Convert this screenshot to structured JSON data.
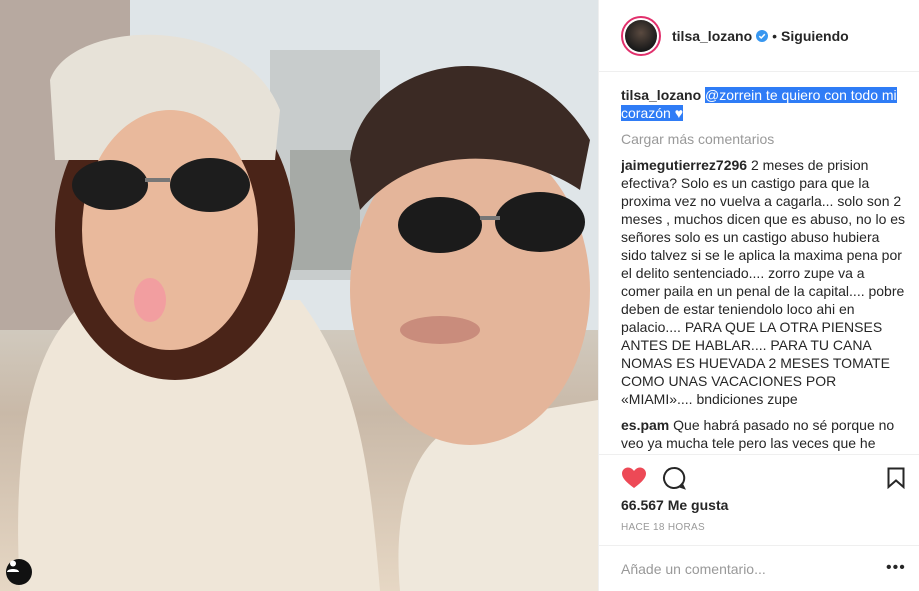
{
  "header": {
    "username": "tilsa_lozano",
    "separator": "•",
    "follow_status": "Siguiendo",
    "verified_icon": "verified-badge-icon"
  },
  "caption": {
    "user": "tilsa_lozano",
    "text": "@zorrein te quiero con todo mi corazón",
    "emoji": "♥"
  },
  "load_more": "Cargar más comentarios",
  "comments": [
    {
      "user": "jaimegutierrez7296",
      "text": "2 meses de prision efectiva? Solo es un castigo para que la proxima vez no vuelva a cagarla... solo son 2 meses , muchos dicen que es abuso, no lo es señores solo es un castigo abuso hubiera sido talvez si se le aplica la maxima pena por el delito sentenciado.... zorro zupe va a comer paila en un penal de la capital.... pobre deben de estar teniendolo loco ahi en palacio.... PARA QUE LA OTRA PIENSES ANTES DE HABLAR.... PARA TU CANA NOMAS ES HUEVADA 2 MESES TOMATE COMO UNAS VACACIONES POR «MIAMI».... bndiciones zupe"
    },
    {
      "user": "es.pam",
      "text": "Que habrá pasado no sé porque no veo ya mucha tele pero las veces que he"
    }
  ],
  "actions": {
    "like_icon": "heart-icon",
    "comment_icon": "comment-icon",
    "save_icon": "bookmark-icon"
  },
  "likes": "66.567 Me gusta",
  "timestamp": "HACE 18 HORAS",
  "add_comment": {
    "placeholder": "Añade un comentario...",
    "more_label": "•••"
  },
  "colors": {
    "like_red": "#ed4956",
    "verified_blue": "#3897f0",
    "highlight_blue": "#2f7cf6"
  }
}
